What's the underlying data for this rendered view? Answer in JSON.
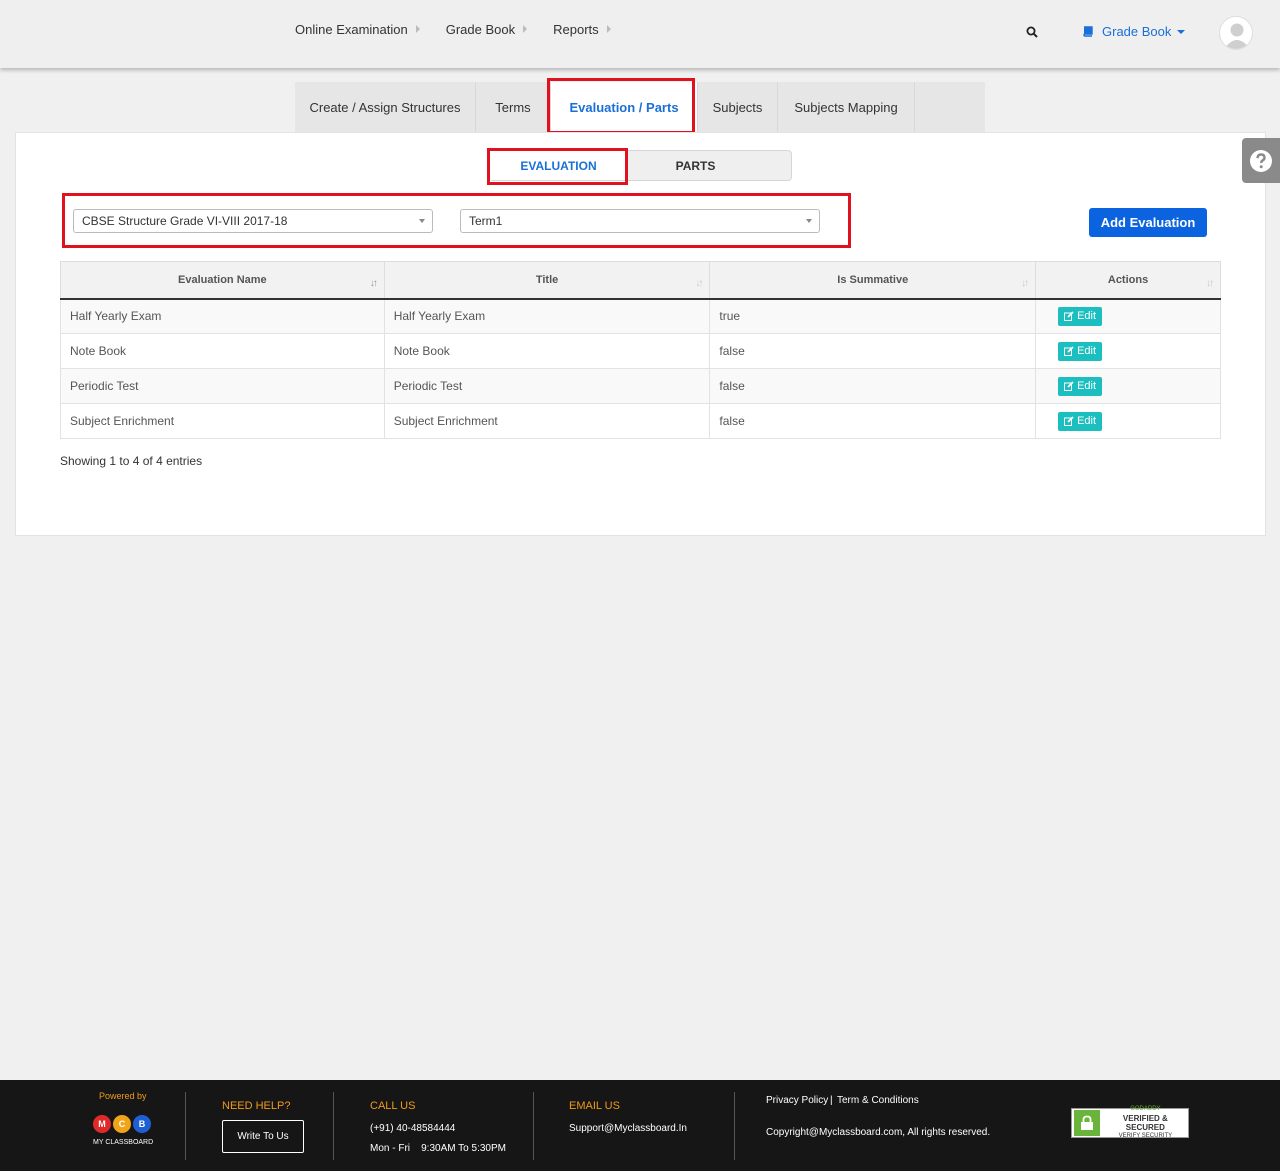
{
  "topnav": {
    "items": [
      {
        "label": "Online Examination"
      },
      {
        "label": "Grade Book"
      },
      {
        "label": "Reports"
      }
    ],
    "module_menu_label": "Grade Book"
  },
  "tabs": [
    {
      "label": "Create / Assign Structures",
      "active": false
    },
    {
      "label": "Terms",
      "active": false
    },
    {
      "label": "Evaluation / Parts",
      "active": true
    },
    {
      "label": "Subjects",
      "active": false
    },
    {
      "label": "Subjects Mapping",
      "active": false
    }
  ],
  "toggle": {
    "evaluation_label": "EVALUATION",
    "parts_label": "PARTS",
    "selected": "EVALUATION"
  },
  "filters": {
    "structure_value": "CBSE Structure Grade VI-VIII 2017-18",
    "term_value": "Term1"
  },
  "add_button_label": "Add Evaluation",
  "table": {
    "columns": [
      "Evaluation Name",
      "Title",
      "Is Summative",
      "Actions"
    ],
    "rows": [
      {
        "name": "Half Yearly Exam",
        "title": "Half Yearly Exam",
        "summative": "true",
        "action": "Edit"
      },
      {
        "name": "Note Book",
        "title": "Note Book",
        "summative": "false",
        "action": "Edit"
      },
      {
        "name": "Periodic Test",
        "title": "Periodic Test",
        "summative": "false",
        "action": "Edit"
      },
      {
        "name": "Subject Enrichment",
        "title": "Subject Enrichment",
        "summative": "false",
        "action": "Edit"
      }
    ]
  },
  "entries_text": "Showing 1 to 4 of 4 entries",
  "footer": {
    "powered_by": "Powered by",
    "logo_letters": [
      "M",
      "C",
      "B"
    ],
    "logo_caption": "MY CLASSBOARD",
    "need_help": "NEED HELP?",
    "write_to_us": "Write To Us",
    "call_us": "CALL US",
    "phone": "(+91) 40-48584444",
    "hours": "Mon - Fri    9:30AM To 5:30PM",
    "email_us": "EMAIL US",
    "email": "Support@Myclassboard.In",
    "privacy": "Privacy Policy",
    "sep": "|",
    "terms": "Term & Conditions",
    "copyright": "Copyright@Myclassboard.com, All rights reserved.",
    "seal_top": "GODADDY",
    "seal_main": "VERIFIED & SECURED",
    "seal_sub": "VERIFY SECURITY"
  },
  "colors": {
    "accent": "#1a6fd8",
    "primary_button": "#0c63e0",
    "edit_button": "#1bbfbf",
    "highlight_box": "#e0121f",
    "footer_bg": "#161616",
    "footer_heading": "#f29a1a"
  }
}
